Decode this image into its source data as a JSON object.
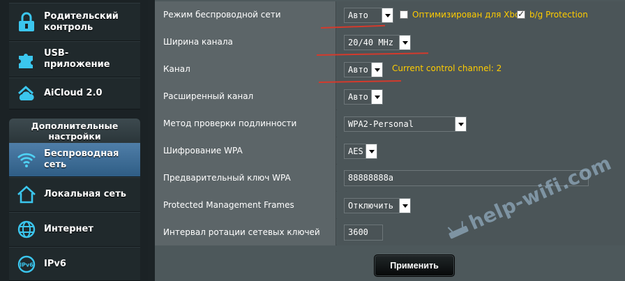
{
  "sidebar": {
    "items": [
      {
        "label": "Родительский контроль",
        "icon": "lock-icon"
      },
      {
        "label": "USB-приложение",
        "icon": "puzzle-icon"
      },
      {
        "label": "AiCloud 2.0",
        "icon": "cloud-home-icon"
      }
    ],
    "advanced_header": "Дополнительные настройки",
    "advanced_items": [
      {
        "label": "Беспроводная сеть",
        "icon": "wifi-icon",
        "active": true
      },
      {
        "label": "Локальная сеть",
        "icon": "home-icon"
      },
      {
        "label": "Интернет",
        "icon": "globe-icon"
      },
      {
        "label": "IPv6",
        "icon": "ipv6-icon"
      }
    ]
  },
  "settings": {
    "wireless_mode": {
      "label": "Режим беспроводной сети",
      "value": "Авто",
      "xbox_label": "Оптимизирован для Xbox",
      "xbox_checked": false,
      "bg_label": "b/g Protection",
      "bg_checked": true
    },
    "channel_width": {
      "label": "Ширина канала",
      "value": "20/40 MHz"
    },
    "channel": {
      "label": "Канал",
      "value": "Авто",
      "note": "Current control channel: 2"
    },
    "ext_channel": {
      "label": "Расширенный канал",
      "value": "Авто"
    },
    "auth_method": {
      "label": "Метод проверки подлинности",
      "value": "WPA2-Personal"
    },
    "wpa_encryption": {
      "label": "Шифрование WPA",
      "value": "AES"
    },
    "wpa_key": {
      "label": "Предварительный ключ WPA",
      "value": "88888888a"
    },
    "pmf": {
      "label": "Protected Management Frames",
      "value": "Отключить"
    },
    "key_rotation": {
      "label": "Интервал ротации сетевых ключей",
      "value": "3600"
    }
  },
  "apply_label": "Применить",
  "watermark": "help-wifi.com",
  "colors": {
    "accent_text": "#ffcc00",
    "active_nav": "#3f6f99",
    "underline": "#d43a2c"
  }
}
